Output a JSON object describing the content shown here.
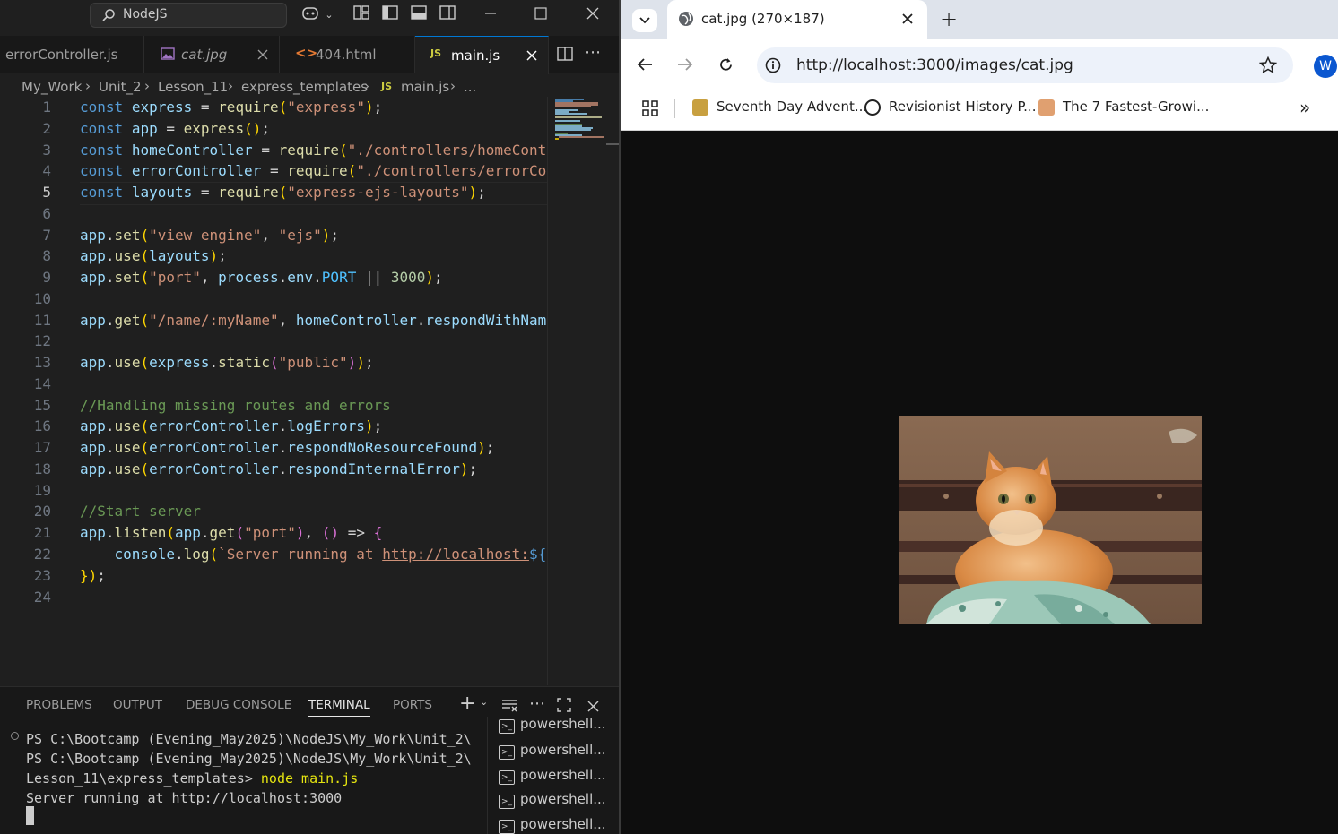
{
  "vscode": {
    "search_label": "NodeJS",
    "tabs": [
      {
        "label": "errorController.js",
        "icon": "js-icon"
      },
      {
        "label": "cat.jpg",
        "icon": "image-icon"
      },
      {
        "label": "404.html",
        "icon": "html-icon"
      },
      {
        "label": "main.js",
        "icon": "js-icon",
        "active": true
      }
    ],
    "tab_js_badge": "JS",
    "breadcrumb": [
      "My_Work",
      "Unit_2",
      "Lesson_11",
      "express_templates",
      "main.js",
      "..."
    ],
    "line_numbers": [
      "1",
      "2",
      "3",
      "4",
      "5",
      "6",
      "7",
      "8",
      "9",
      "10",
      "11",
      "12",
      "13",
      "14",
      "15",
      "16",
      "17",
      "18",
      "19",
      "20",
      "21",
      "22",
      "23",
      "24"
    ],
    "code_lines": [
      "const express = require(\"express\");",
      "const app = express();",
      "const homeController = require(\"./controllers/homeCont",
      "const errorController = require(\"./controllers/errorCo",
      "const layouts = require(\"express-ejs-layouts\");",
      "",
      "app.set(\"view engine\", \"ejs\");",
      "app.use(layouts);",
      "app.set(\"port\", process.env.PORT || 3000);",
      "",
      "app.get(\"/name/:myName\", homeController.respondWithNam",
      "",
      "app.use(express.static(\"public\"));",
      "",
      "//Handling missing routes and errors",
      "app.use(errorController.logErrors);",
      "app.use(errorController.respondNoResourceFound);",
      "app.use(errorController.respondInternalError);",
      "",
      "//Start server",
      "app.listen(app.get(\"port\"), () => {",
      "    console.log(`Server running at http://localhost:${",
      "});",
      ""
    ],
    "panel_tabs": [
      "PROBLEMS",
      "OUTPUT",
      "DEBUG CONSOLE",
      "TERMINAL",
      "PORTS"
    ],
    "active_panel_tab": "TERMINAL",
    "terminal_lines": [
      "PS C:\\Bootcamp (Evening_May2025)\\NodeJS\\My_Work\\Unit_2\\",
      "PS C:\\Bootcamp (Evening_May2025)\\NodeJS\\My_Work\\Unit_2\\",
      "Lesson_11\\express_templates> node main.js",
      "Server running at http://localhost:3000"
    ],
    "terminal_instances": [
      "powershell...",
      "powershell...",
      "powershell...",
      "powershell...",
      "powershell..."
    ]
  },
  "chrome": {
    "tab_title": "cat.jpg (270×187)",
    "url": "http://localhost:3000/images/cat.jpg",
    "profile_initial": "W",
    "bookmarks": [
      {
        "label": "Seventh Day Advent...",
        "color": "#c8a040"
      },
      {
        "label": "Revisionist History P...",
        "color": "#222222"
      },
      {
        "label": "The 7 Fastest-Growi...",
        "color": "#e0a070"
      }
    ],
    "image_alt": "cat"
  },
  "colors": {
    "accent": "#0078d4",
    "profile_bg": "#0b57d0"
  }
}
